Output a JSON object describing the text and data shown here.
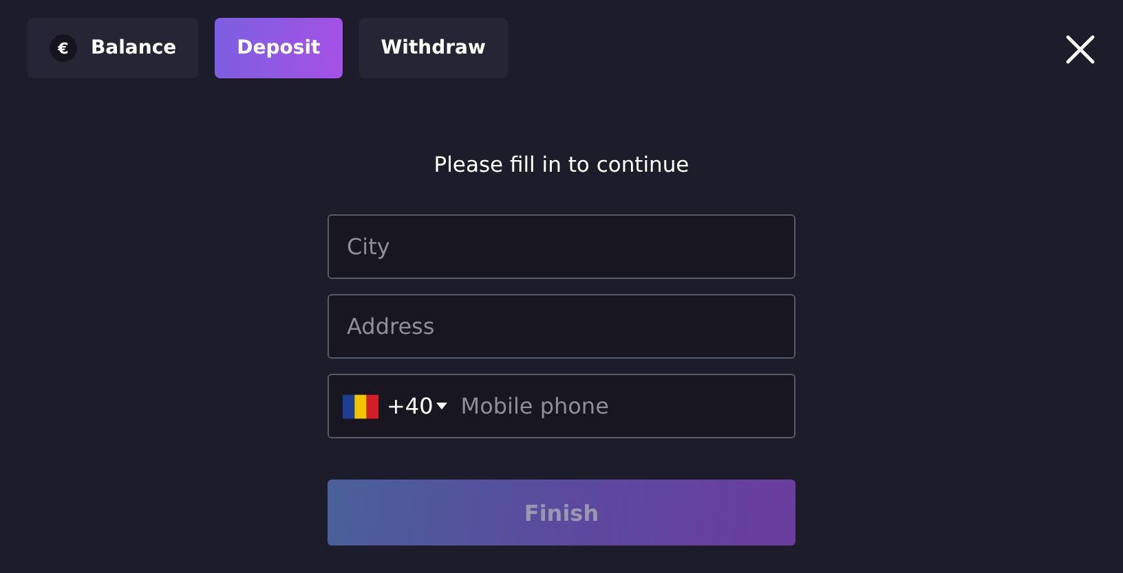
{
  "tabs": [
    {
      "label": "Balance",
      "badge": "€",
      "selected": false
    },
    {
      "label": "Deposit",
      "selected": true
    },
    {
      "label": "Withdraw",
      "selected": false
    }
  ],
  "form": {
    "title": "Please fill in to continue",
    "fields": [
      {
        "kind": "text",
        "placeholder": "City"
      },
      {
        "kind": "text",
        "placeholder": "Address"
      },
      {
        "kind": "phone",
        "code": "+40",
        "placeholder": "Mobile phone"
      }
    ],
    "submit": {
      "label": "Finish",
      "disabled": true
    }
  }
}
